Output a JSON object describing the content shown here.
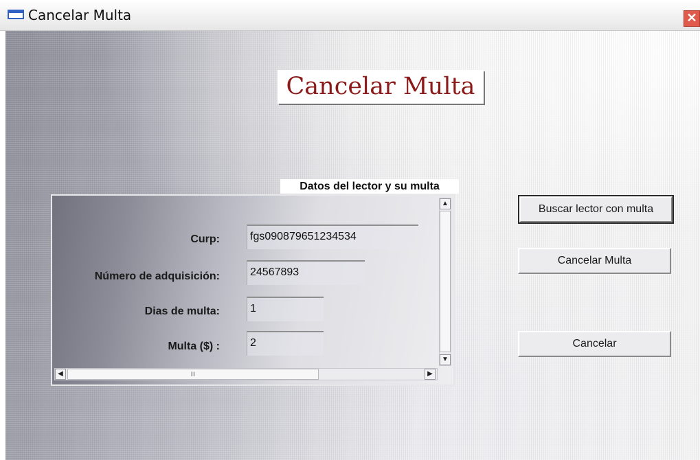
{
  "window": {
    "title": "Cancelar Multa",
    "close_glyph": "✕"
  },
  "header": {
    "title": "Cancelar Multa"
  },
  "panel": {
    "label": "Datos del lector y su multa",
    "fields": {
      "curp": {
        "label": "Curp:",
        "value": "fgs090879651234534"
      },
      "numero": {
        "label": "Número de adquisición:",
        "value": "24567893"
      },
      "dias": {
        "label": "Dias de multa:",
        "value": "1"
      },
      "multa": {
        "label": "Multa ($) :",
        "value": "2"
      }
    },
    "scroll": {
      "up": "▲",
      "down": "▼",
      "left": "◀",
      "right": "▶",
      "grip": "III"
    }
  },
  "buttons": {
    "buscar": "Buscar lector con multa",
    "cancelar_multa": "Cancelar Multa",
    "cancelar": "Cancelar"
  },
  "icons": {
    "app": "window-icon",
    "close": "close-icon"
  }
}
